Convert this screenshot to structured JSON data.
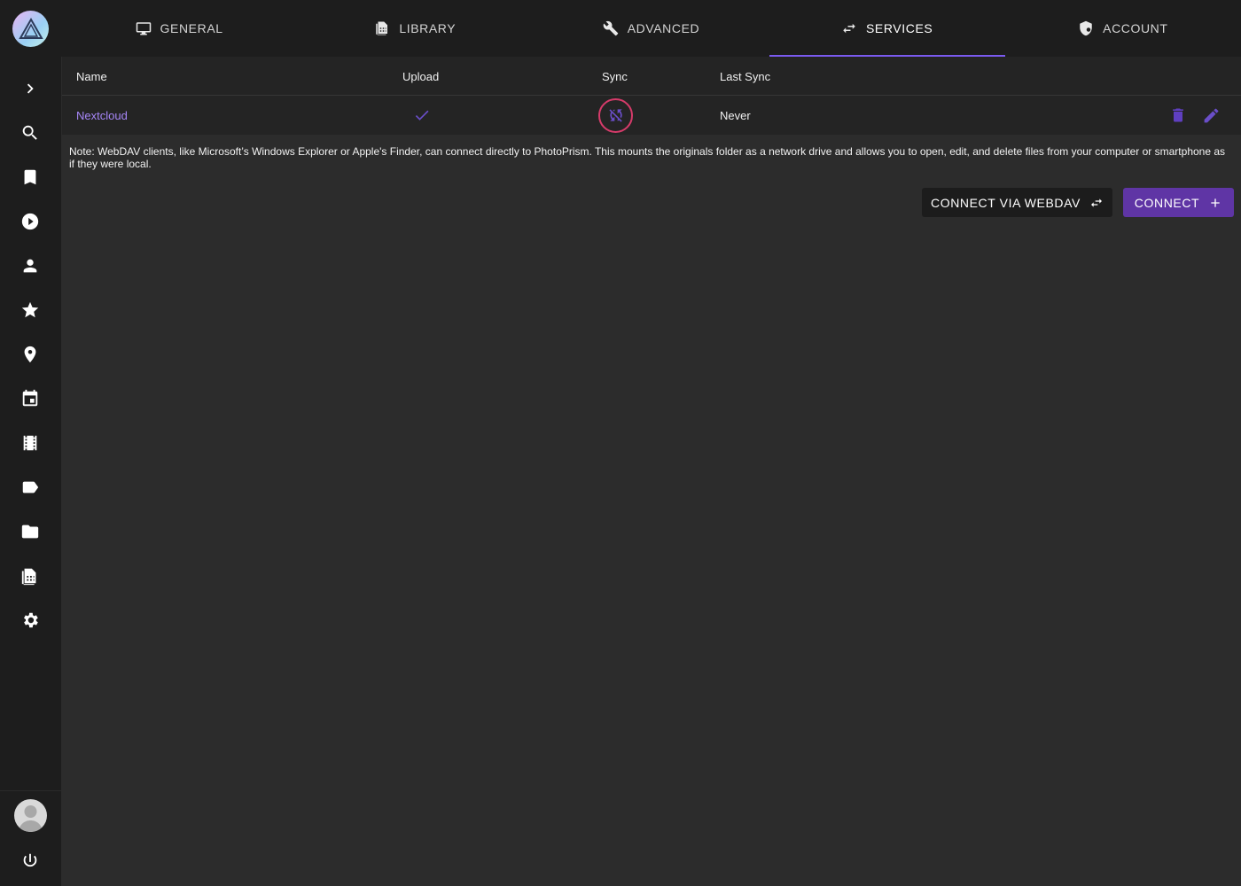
{
  "sidebar": {
    "logo": "photoprism-logo",
    "items": [
      {
        "name": "expand-icon"
      },
      {
        "name": "search-icon"
      },
      {
        "name": "bookmark-icon"
      },
      {
        "name": "play-icon"
      },
      {
        "name": "person-icon"
      },
      {
        "name": "star-icon"
      },
      {
        "name": "place-icon"
      },
      {
        "name": "calendar-icon"
      },
      {
        "name": "movie-icon"
      },
      {
        "name": "label-icon"
      },
      {
        "name": "folder-icon"
      },
      {
        "name": "library-icon"
      },
      {
        "name": "settings-icon"
      }
    ],
    "logout": "power-icon"
  },
  "tabs": [
    {
      "label": "GENERAL",
      "icon": "monitor-icon"
    },
    {
      "label": "LIBRARY",
      "icon": "library-icon"
    },
    {
      "label": "ADVANCED",
      "icon": "wrench-icon"
    },
    {
      "label": "SERVICES",
      "icon": "swap-icon",
      "active": true
    },
    {
      "label": "ACCOUNT",
      "icon": "shield-account-icon"
    }
  ],
  "table": {
    "headers": {
      "name": "Name",
      "upload": "Upload",
      "sync": "Sync",
      "last_sync": "Last Sync"
    },
    "rows": [
      {
        "name": "Nextcloud",
        "upload": "check-icon",
        "sync": "sync-disabled-icon",
        "last_sync": "Never"
      }
    ]
  },
  "note": "Note: WebDAV clients, like Microsoft’s Windows Explorer or Apple's Finder, can connect directly to PhotoPrism. This mounts the originals folder as a network drive and allows you to open, edit, and delete files from your computer or smartphone as if they were local.",
  "actions": {
    "webdav_label": "CONNECT VIA WEBDAV",
    "connect_label": "CONNECT"
  },
  "colors": {
    "accent": "#7a5af0",
    "link": "#a686f7",
    "button_primary": "#5f35a5",
    "sync_ring": "#d63b6a"
  }
}
